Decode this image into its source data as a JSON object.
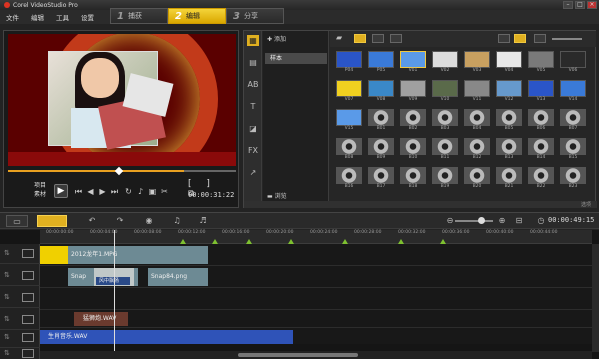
{
  "window": {
    "title": "Corel VideoStudio Pro"
  },
  "menu": [
    "文件",
    "编辑",
    "工具",
    "设置"
  ],
  "steps": [
    {
      "num": "1",
      "label": "捕获"
    },
    {
      "num": "2",
      "label": "编辑"
    },
    {
      "num": "3",
      "label": "分享"
    }
  ],
  "preview": {
    "project_label": "项目",
    "clip_label": "素材",
    "timecode": "00:00:31:22",
    "progress": 0.77
  },
  "library": {
    "add_label": "添加",
    "folder": "样本",
    "browse_label": "浏览",
    "hint": "选项",
    "thumbs": [
      [
        "P04",
        "P05",
        "V01",
        "V02",
        "V03",
        "V04",
        "V05",
        "V06"
      ],
      [
        "V07",
        "V08",
        "V09",
        "V10",
        "V11",
        "V12",
        "V13",
        "V14"
      ],
      [
        "V15",
        "B01",
        "B02",
        "B03",
        "B04",
        "B05",
        "B06",
        "B07"
      ],
      [
        "B08",
        "B09",
        "B10",
        "B11",
        "B12",
        "B13",
        "B14",
        "B15"
      ],
      [
        "B16",
        "B17",
        "B18",
        "B19",
        "B20",
        "B21",
        "B22",
        "B23"
      ]
    ]
  },
  "timeline": {
    "time": "00:00:49:15",
    "ruler": [
      "00:00:00:00",
      "00:00:04:00",
      "00:00:08:00",
      "00:00:12:00",
      "00:00:16:00",
      "00:00:20:00",
      "00:00:24:00",
      "00:00:28:00",
      "00:00:32:00",
      "00:00:36:00",
      "00:00:40:00",
      "00:00:44:00"
    ],
    "clips": {
      "video": "2012龙年1.MPG",
      "overlay_a": "Snap",
      "overlay_b": "Snap84.png",
      "overlay_text": "风中飘扬",
      "voice": "猛狮炮.WAV",
      "music": "生肖音乐.WAV"
    }
  }
}
